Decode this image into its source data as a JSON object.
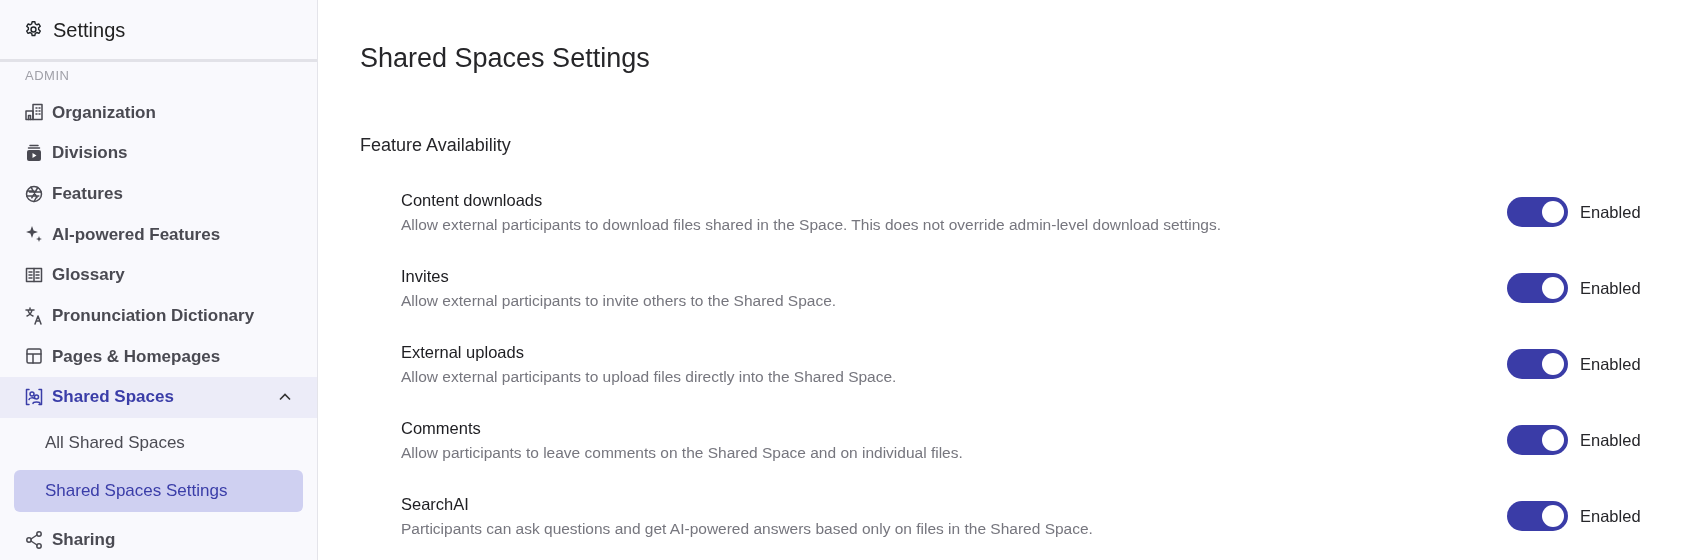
{
  "sidebar": {
    "title": "Settings",
    "section_label": "ADMIN",
    "items": [
      {
        "label": "Organization",
        "selected": false
      },
      {
        "label": "Divisions",
        "selected": false
      },
      {
        "label": "Features",
        "selected": false
      },
      {
        "label": "AI-powered Features",
        "selected": false
      },
      {
        "label": "Glossary",
        "selected": false
      },
      {
        "label": "Pronunciation Dictionary",
        "selected": false
      },
      {
        "label": "Pages & Homepages",
        "selected": false
      },
      {
        "label": "Shared Spaces",
        "selected": true,
        "expanded": true,
        "children": [
          {
            "label": "All Shared Spaces",
            "selected": false
          },
          {
            "label": "Shared Spaces Settings",
            "selected": true
          }
        ]
      },
      {
        "label": "Sharing",
        "selected": false
      }
    ]
  },
  "main": {
    "title": "Shared Spaces Settings",
    "section": "Feature Availability",
    "settings": [
      {
        "name": "Content downloads",
        "description": "Allow external participants to download files shared in the Space. This does not override admin-level download settings.",
        "on": true,
        "state_label": "Enabled"
      },
      {
        "name": "Invites",
        "description": "Allow external participants to invite others to the Shared Space.",
        "on": true,
        "state_label": "Enabled"
      },
      {
        "name": "External uploads",
        "description": "Allow external participants to upload files directly into the Shared Space.",
        "on": true,
        "state_label": "Enabled"
      },
      {
        "name": "Comments",
        "description": "Allow participants to leave comments on the Shared Space and on individual files.",
        "on": true,
        "state_label": "Enabled"
      },
      {
        "name": "SearchAI",
        "description": "Participants can ask questions and get AI-powered answers based only on files in the Shared Space.",
        "on": true,
        "state_label": "Enabled"
      }
    ]
  }
}
